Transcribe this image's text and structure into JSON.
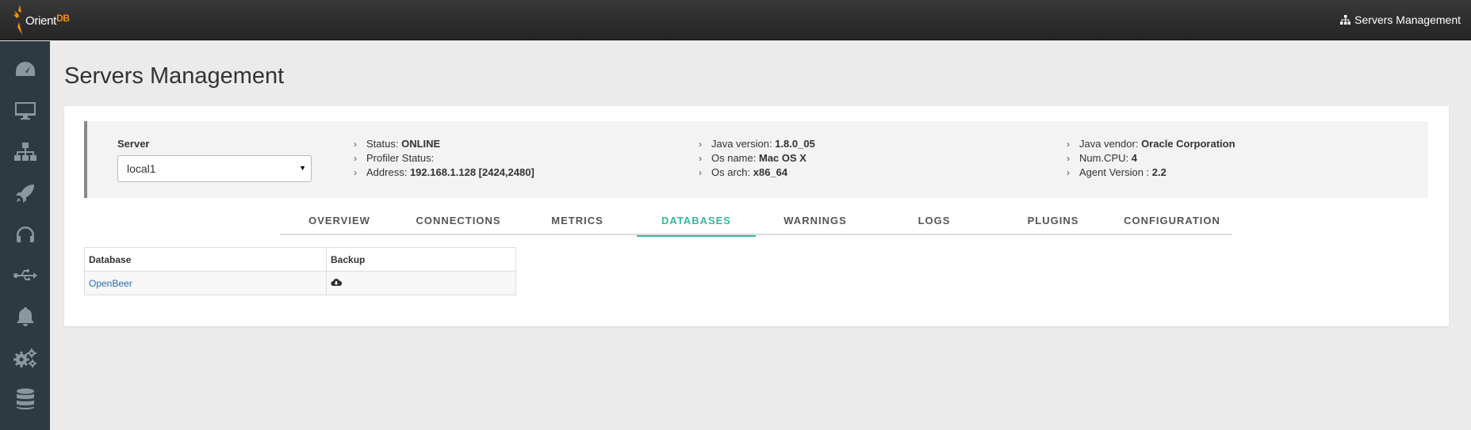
{
  "header": {
    "logo_text": "Orient",
    "logo_suffix": "DB",
    "right_link": "Servers Management",
    "right_icon": "sitemap-icon"
  },
  "sidebar": {
    "items": [
      {
        "icon": "dashboard-icon"
      },
      {
        "icon": "monitor-icon"
      },
      {
        "icon": "sitemap-icon"
      },
      {
        "icon": "rocket-icon"
      },
      {
        "icon": "headphones-icon"
      },
      {
        "icon": "usb-icon"
      },
      {
        "icon": "bell-icon"
      },
      {
        "icon": "gears-icon"
      },
      {
        "icon": "database-icon"
      }
    ]
  },
  "page": {
    "title": "Servers Management"
  },
  "server": {
    "label": "Server",
    "selected": "local1"
  },
  "info": {
    "col1": [
      {
        "label": "Status:",
        "value": "ONLINE"
      },
      {
        "label": "Profiler Status:",
        "value": ""
      },
      {
        "label": "Address:",
        "value": "192.168.1.128 [2424,2480]"
      }
    ],
    "col2": [
      {
        "label": "Java version:",
        "value": "1.8.0_05"
      },
      {
        "label": "Os name:",
        "value": "Mac OS X"
      },
      {
        "label": "Os arch:",
        "value": "x86_64"
      }
    ],
    "col3": [
      {
        "label": "Java vendor:",
        "value": "Oracle Corporation"
      },
      {
        "label": "Num.CPU:",
        "value": "4"
      },
      {
        "label": "Agent Version :",
        "value": "2.2"
      }
    ]
  },
  "tabs": [
    {
      "label": "OVERVIEW",
      "active": false
    },
    {
      "label": "CONNECTIONS",
      "active": false
    },
    {
      "label": "METRICS",
      "active": false
    },
    {
      "label": "DATABASES",
      "active": true
    },
    {
      "label": "WARNINGS",
      "active": false
    },
    {
      "label": "LOGS",
      "active": false
    },
    {
      "label": "PLUGINS",
      "active": false
    },
    {
      "label": "CONFIGURATION",
      "active": false
    }
  ],
  "colors": {
    "accent": "#3ab59c",
    "topbar": "#2b2b2b",
    "sidebar": "#2e3a41",
    "link": "#2a6fb5"
  },
  "table": {
    "headers": [
      "Database",
      "Backup"
    ],
    "rows": [
      {
        "database": "OpenBeer",
        "backup_icon": "cloud-download-icon"
      }
    ]
  }
}
